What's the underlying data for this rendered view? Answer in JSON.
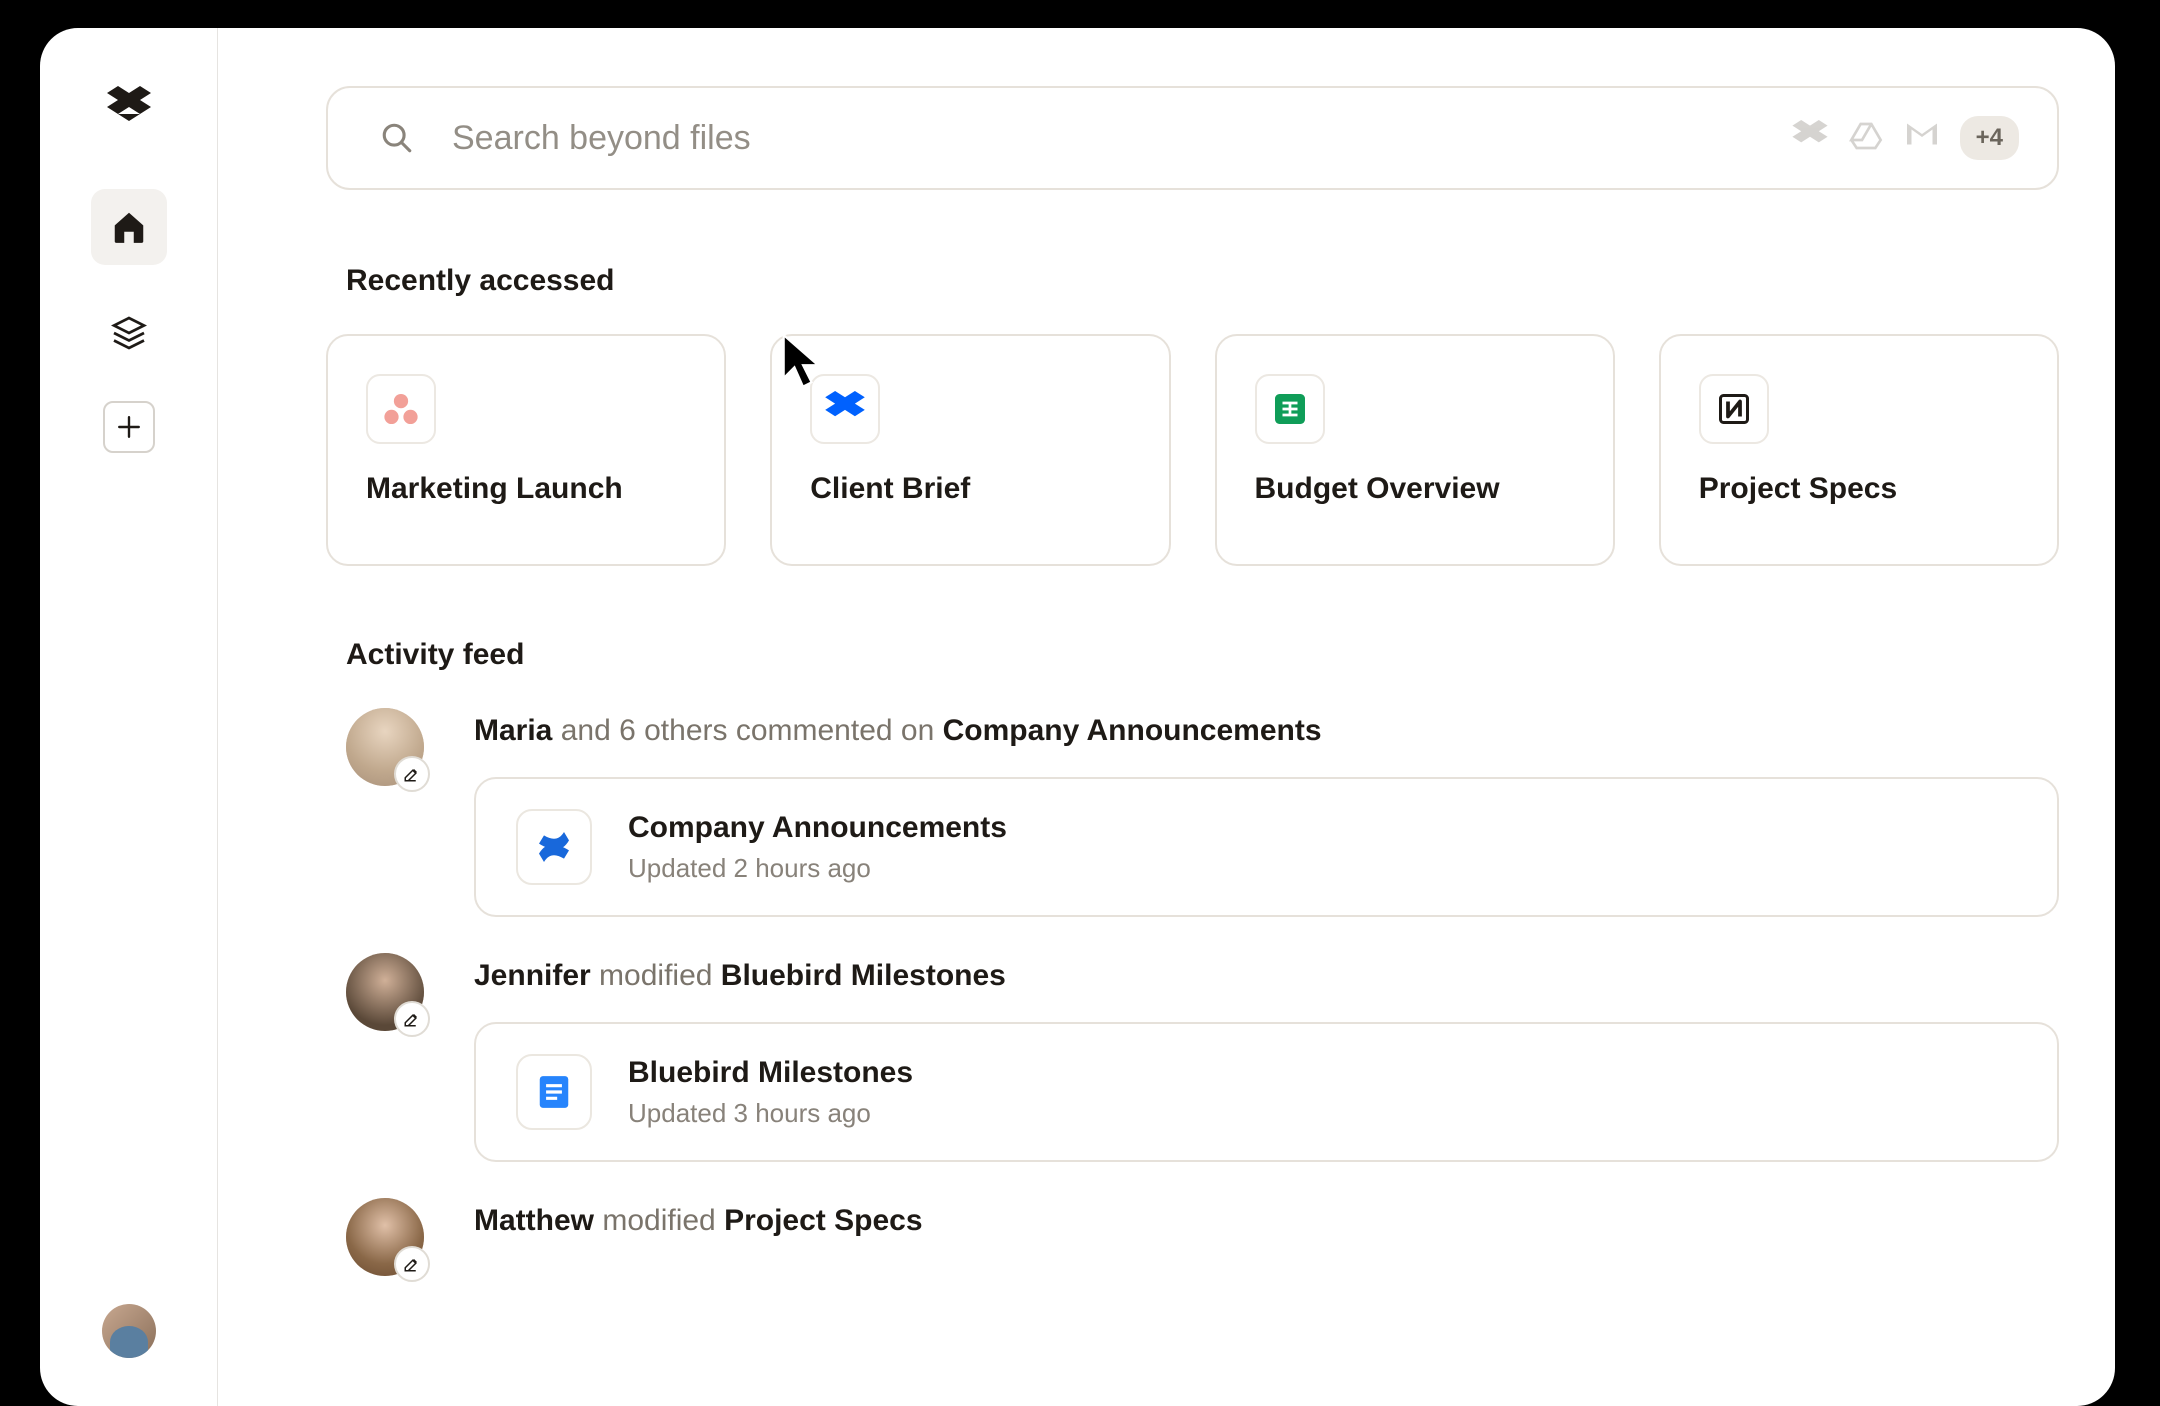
{
  "search": {
    "placeholder": "Search beyond files",
    "more_count": "+4"
  },
  "recently": {
    "title": "Recently accessed",
    "items": [
      {
        "title": "Marketing Launch",
        "icon": "asana"
      },
      {
        "title": "Client Brief",
        "icon": "dropbox"
      },
      {
        "title": "Budget Overview",
        "icon": "sheets"
      },
      {
        "title": "Project Specs",
        "icon": "notion"
      }
    ]
  },
  "activity": {
    "title": "Activity feed",
    "items": [
      {
        "user": "Maria",
        "action_prefix": " and 6 others commented on ",
        "doc": "Company Announcements",
        "card_title": "Company Announcements",
        "card_meta": "Updated 2 hours ago",
        "card_icon": "confluence"
      },
      {
        "user": "Jennifer",
        "action_prefix": " modified ",
        "doc": "Bluebird Milestones",
        "card_title": "Bluebird Milestones",
        "card_meta": "Updated 3 hours ago",
        "card_icon": "gdocs"
      },
      {
        "user": "Matthew",
        "action_prefix": " modified ",
        "doc": "Project Specs",
        "card_title": "",
        "card_meta": "",
        "card_icon": ""
      }
    ]
  }
}
